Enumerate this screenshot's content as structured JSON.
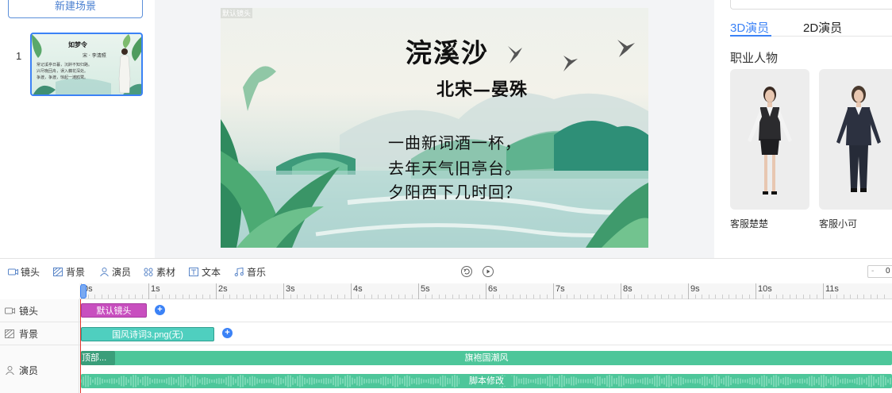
{
  "left_panel": {
    "new_scene_label": "新建场景",
    "scene_index": "1",
    "thumbnail": {
      "title": "如梦令",
      "author": "宋 · 李清照",
      "lines": [
        "常记溪亭日暮，沉醉不知归路。",
        "兴尽晚回舟，误入藕花深处。",
        "争渡，争渡，惊起一滩鸥鹭。"
      ]
    }
  },
  "stage": {
    "camera_label": "默认镜头",
    "title": "浣溪沙",
    "author": "北宋—晏殊",
    "poem_lines": [
      "一曲新词酒一杯，",
      "去年天气旧亭台。",
      "夕阳西下几时回？"
    ]
  },
  "right_panel": {
    "tabs": [
      {
        "label": "3D演员",
        "active": true
      },
      {
        "label": "2D演员",
        "active": false
      }
    ],
    "section_title": "职业人物",
    "actors": [
      {
        "name": "客服楚楚"
      },
      {
        "name": "客服小可"
      }
    ]
  },
  "toolbar": {
    "items": [
      {
        "label": "镜头",
        "icon": "camera-icon"
      },
      {
        "label": "背景",
        "icon": "background-icon"
      },
      {
        "label": "演员",
        "icon": "actor-icon"
      },
      {
        "label": "素材",
        "icon": "material-icon"
      },
      {
        "label": "文本",
        "icon": "text-icon"
      },
      {
        "label": "音乐",
        "icon": "music-icon"
      }
    ],
    "undo_icon": "undo-icon",
    "play_icon": "play-icon",
    "zoom_minus": "-",
    "zoom_value": "0"
  },
  "timeline": {
    "ruler_ticks": [
      "0s",
      "1s",
      "2s",
      "3s",
      "4s",
      "5s",
      "6s",
      "7s",
      "8s",
      "9s",
      "10s",
      "11s"
    ],
    "tracks": [
      {
        "label": "镜头",
        "icon": "camera-icon"
      },
      {
        "label": "背景",
        "icon": "background-icon"
      },
      {
        "label": "演员",
        "icon": "actor-icon"
      }
    ],
    "clips": {
      "camera": "默认镜头",
      "background": "国风诗词3.png(无)",
      "actor_action_head": "顶部...",
      "actor_costume": "旗袍国潮风",
      "actor_script": "脚本修改"
    }
  },
  "colors": {
    "accent": "#3b82f6",
    "camera_clip": "#c84fbf",
    "background_clip": "#4fcfbf",
    "actor_clip": "#4dc69a",
    "playhead": "#e0312b"
  }
}
